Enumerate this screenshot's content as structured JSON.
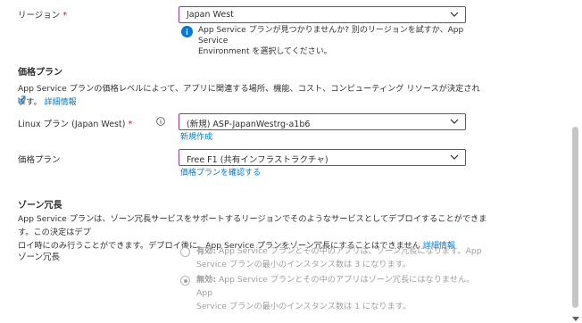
{
  "region": {
    "label": "リージョン",
    "required": "*",
    "value": "Japan West",
    "info": "App Service プランが見つかりませんか? 別のリージョンを試すか、App Service Environment を選択してください。",
    "info_line1": "App Service プランが見つかりませんか? 別のリージョンを試すか、App Service",
    "info_line2": "Environment を選択してください。"
  },
  "pricing": {
    "heading": "価格プラン",
    "description": "App Service プランの価格レベルによって、アプリに関連する場所、機能、コスト、コンピューティング リソースが決定されます。",
    "learn_more": "詳細情報",
    "linux_plan_label": "Linux プラン (Japan West)",
    "linux_plan_required": "*",
    "linux_plan_value": "(新規) ASP-JapanWestrg-a1b6",
    "create_new": "新規作成",
    "plan_label": "価格プラン",
    "plan_value": "Free F1 (共有インフラストラクチャ)",
    "explore_plans": "価格プランを確認する"
  },
  "zone": {
    "heading": "ゾーン冗長",
    "description_line1": "App Service プランは、ゾーン冗長サービスをサポートするリージョンでそのようなサービスとしてデプロイすることができます。この決定はデプ",
    "description_line2": "ロイ時にのみ行うことができます。デプロイ後に、App Service プランをゾーン冗長にすることはできません",
    "learn_more": "詳細情報",
    "label": "ゾーン冗長",
    "options": [
      {
        "title": "有効:",
        "line1": "App Service プランとその中のアプリは、ゾーン冗長になります。App",
        "line2": "Service プランの最小のインスタンス数は 3 になります。",
        "selected": false
      },
      {
        "title": "無効:",
        "line1": "App Service プランとその中のアプリはゾーン冗長にはなりません。App",
        "line2": "Service プランの最小のインスタンス数は 1 になります。",
        "selected": true
      }
    ]
  },
  "colors": {
    "accent": "#8a3a9e",
    "link": "#0078d4",
    "required": "#a4262c",
    "info_icon": "#0078d4",
    "disabled_text": "#a19f9d"
  }
}
